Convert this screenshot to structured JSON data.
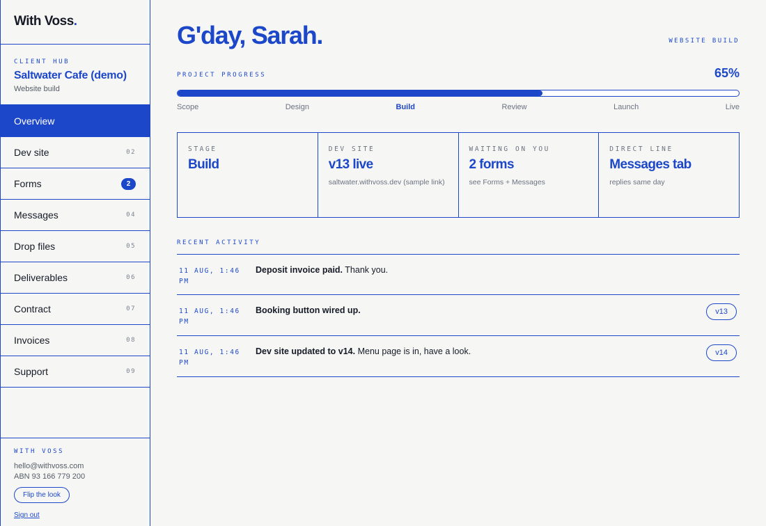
{
  "brand": {
    "name": "With Voss",
    "dot": "."
  },
  "client": {
    "eyebrow": "CLIENT HUB",
    "name": "Saltwater Cafe (demo)",
    "sub": "Website build"
  },
  "nav": [
    {
      "label": "Overview",
      "num": ""
    },
    {
      "label": "Dev site",
      "num": "02"
    },
    {
      "label": "Forms",
      "badge": "2"
    },
    {
      "label": "Messages",
      "num": "04"
    },
    {
      "label": "Drop files",
      "num": "05"
    },
    {
      "label": "Deliverables",
      "num": "06"
    },
    {
      "label": "Contract",
      "num": "07"
    },
    {
      "label": "Invoices",
      "num": "08"
    },
    {
      "label": "Support",
      "num": "09"
    }
  ],
  "footer": {
    "eyebrow": "WITH VOSS",
    "email": "hello@withvoss.com",
    "abn": "ABN 93 166 779 200",
    "flip_label": "Flip the look",
    "signout_label": "Sign out"
  },
  "main": {
    "greeting": "G'day, Sarah.",
    "tag": "WEBSITE BUILD",
    "progress_label": "PROJECT PROGRESS",
    "progress_text": "65%",
    "progress_value": 0.65,
    "stages": [
      "Scope",
      "Design",
      "Build",
      "Review",
      "Launch",
      "Live"
    ],
    "current_stage": "Build"
  },
  "cards": [
    {
      "label": "STAGE",
      "value": "Build",
      "sub": ""
    },
    {
      "label": "DEV SITE",
      "value": "v13 live",
      "sub": "saltwater.withvoss.dev (sample link)"
    },
    {
      "label": "WAITING ON YOU",
      "value": "2 forms",
      "sub": "see Forms + Messages"
    },
    {
      "label": "DIRECT LINE",
      "value": "Messages tab",
      "sub": "replies same day"
    }
  ],
  "recent": {
    "label": "RECENT ACTIVITY",
    "items": [
      {
        "time": "11 AUG, 1:46 PM",
        "bold": "Deposit invoice paid.",
        "rest": " Thank you.",
        "pill": ""
      },
      {
        "time": "11 AUG, 1:46 PM",
        "bold": "Booking button wired up.",
        "rest": "",
        "pill": "v13"
      },
      {
        "time": "11 AUG, 1:46 PM",
        "bold": "Dev site updated to v14.",
        "rest": " Menu page is in, have a look.",
        "pill": "v14"
      }
    ]
  },
  "colors": {
    "accent": "#1d47c9",
    "background": "#f6f7f5",
    "text": "#161a26"
  }
}
